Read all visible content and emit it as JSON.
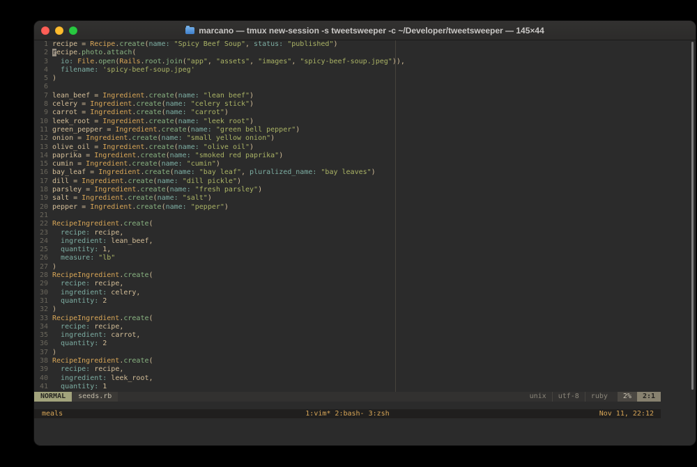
{
  "window": {
    "title": "marcano — tmux new-session -s tweetsweeper -c ~/Developer/tweetsweeper — 145×44"
  },
  "colors": {
    "terminal_bg": "#2b2b2b",
    "fg": "#d4be98",
    "class": "#d8a657",
    "method": "#89b482",
    "key": "#7daea3",
    "string": "#aab365",
    "number": "#d4be98",
    "line_number": "#6b675c",
    "mode_bg": "#a2a37c",
    "tmux_accent": "#d8a657"
  },
  "editor": {
    "cursor": {
      "line": 2,
      "col": 1
    },
    "lines": [
      {
        "num": 1,
        "tokens": [
          [
            "v",
            "recipe = "
          ],
          [
            "c",
            "Recipe"
          ],
          [
            "v",
            "."
          ],
          [
            "m",
            "create"
          ],
          [
            "v",
            "("
          ],
          [
            "k",
            "name:"
          ],
          [
            "v",
            " "
          ],
          [
            "s",
            "\"Spicy Beef Soup\""
          ],
          [
            "v",
            ", "
          ],
          [
            "k",
            "status:"
          ],
          [
            "v",
            " "
          ],
          [
            "s",
            "\"published\""
          ],
          [
            "v",
            ")"
          ]
        ]
      },
      {
        "num": 2,
        "tokens": [
          [
            "v",
            "recipe."
          ],
          [
            "m",
            "photo"
          ],
          [
            "v",
            "."
          ],
          [
            "m",
            "attach"
          ],
          [
            "v",
            "("
          ]
        ]
      },
      {
        "num": 3,
        "tokens": [
          [
            "v",
            "  "
          ],
          [
            "k",
            "io:"
          ],
          [
            "v",
            " "
          ],
          [
            "c",
            "File"
          ],
          [
            "v",
            "."
          ],
          [
            "m",
            "open"
          ],
          [
            "v",
            "("
          ],
          [
            "c",
            "Rails"
          ],
          [
            "v",
            "."
          ],
          [
            "m",
            "root"
          ],
          [
            "v",
            "."
          ],
          [
            "m",
            "join"
          ],
          [
            "v",
            "("
          ],
          [
            "s",
            "\"app\""
          ],
          [
            "v",
            ", "
          ],
          [
            "s",
            "\"assets\""
          ],
          [
            "v",
            ", "
          ],
          [
            "s",
            "\"images\""
          ],
          [
            "v",
            ", "
          ],
          [
            "s",
            "\"spicy-beef-soup.jpeg\""
          ],
          [
            "v",
            ")),"
          ]
        ]
      },
      {
        "num": 4,
        "tokens": [
          [
            "v",
            "  "
          ],
          [
            "k",
            "filename:"
          ],
          [
            "v",
            " "
          ],
          [
            "s",
            "'spicy-beef-soup.jpeg'"
          ]
        ]
      },
      {
        "num": 5,
        "tokens": [
          [
            "v",
            ")"
          ]
        ]
      },
      {
        "num": 6,
        "tokens": []
      },
      {
        "num": 7,
        "tokens": [
          [
            "v",
            "lean_beef = "
          ],
          [
            "c",
            "Ingredient"
          ],
          [
            "v",
            "."
          ],
          [
            "m",
            "create"
          ],
          [
            "v",
            "("
          ],
          [
            "k",
            "name:"
          ],
          [
            "v",
            " "
          ],
          [
            "s",
            "\"lean beef\""
          ],
          [
            "v",
            ")"
          ]
        ]
      },
      {
        "num": 8,
        "tokens": [
          [
            "v",
            "celery = "
          ],
          [
            "c",
            "Ingredient"
          ],
          [
            "v",
            "."
          ],
          [
            "m",
            "create"
          ],
          [
            "v",
            "("
          ],
          [
            "k",
            "name:"
          ],
          [
            "v",
            " "
          ],
          [
            "s",
            "\"celery stick\""
          ],
          [
            "v",
            ")"
          ]
        ]
      },
      {
        "num": 9,
        "tokens": [
          [
            "v",
            "carrot = "
          ],
          [
            "c",
            "Ingredient"
          ],
          [
            "v",
            "."
          ],
          [
            "m",
            "create"
          ],
          [
            "v",
            "("
          ],
          [
            "k",
            "name:"
          ],
          [
            "v",
            " "
          ],
          [
            "s",
            "\"carrot\""
          ],
          [
            "v",
            ")"
          ]
        ]
      },
      {
        "num": 10,
        "tokens": [
          [
            "v",
            "leek_root = "
          ],
          [
            "c",
            "Ingredient"
          ],
          [
            "v",
            "."
          ],
          [
            "m",
            "create"
          ],
          [
            "v",
            "("
          ],
          [
            "k",
            "name:"
          ],
          [
            "v",
            " "
          ],
          [
            "s",
            "\"leek root\""
          ],
          [
            "v",
            ")"
          ]
        ]
      },
      {
        "num": 11,
        "tokens": [
          [
            "v",
            "green_pepper = "
          ],
          [
            "c",
            "Ingredient"
          ],
          [
            "v",
            "."
          ],
          [
            "m",
            "create"
          ],
          [
            "v",
            "("
          ],
          [
            "k",
            "name:"
          ],
          [
            "v",
            " "
          ],
          [
            "s",
            "\"green bell pepper\""
          ],
          [
            "v",
            ")"
          ]
        ]
      },
      {
        "num": 12,
        "tokens": [
          [
            "v",
            "onion = "
          ],
          [
            "c",
            "Ingredient"
          ],
          [
            "v",
            "."
          ],
          [
            "m",
            "create"
          ],
          [
            "v",
            "("
          ],
          [
            "k",
            "name:"
          ],
          [
            "v",
            " "
          ],
          [
            "s",
            "\"small yellow onion\""
          ],
          [
            "v",
            ")"
          ]
        ]
      },
      {
        "num": 13,
        "tokens": [
          [
            "v",
            "olive_oil = "
          ],
          [
            "c",
            "Ingredient"
          ],
          [
            "v",
            "."
          ],
          [
            "m",
            "create"
          ],
          [
            "v",
            "("
          ],
          [
            "k",
            "name:"
          ],
          [
            "v",
            " "
          ],
          [
            "s",
            "\"olive oil\""
          ],
          [
            "v",
            ")"
          ]
        ]
      },
      {
        "num": 14,
        "tokens": [
          [
            "v",
            "paprika = "
          ],
          [
            "c",
            "Ingredient"
          ],
          [
            "v",
            "."
          ],
          [
            "m",
            "create"
          ],
          [
            "v",
            "("
          ],
          [
            "k",
            "name:"
          ],
          [
            "v",
            " "
          ],
          [
            "s",
            "\"smoked red paprika\""
          ],
          [
            "v",
            ")"
          ]
        ]
      },
      {
        "num": 15,
        "tokens": [
          [
            "v",
            "cumin = "
          ],
          [
            "c",
            "Ingredient"
          ],
          [
            "v",
            "."
          ],
          [
            "m",
            "create"
          ],
          [
            "v",
            "("
          ],
          [
            "k",
            "name:"
          ],
          [
            "v",
            " "
          ],
          [
            "s",
            "\"cumin\""
          ],
          [
            "v",
            ")"
          ]
        ]
      },
      {
        "num": 16,
        "tokens": [
          [
            "v",
            "bay_leaf = "
          ],
          [
            "c",
            "Ingredient"
          ],
          [
            "v",
            "."
          ],
          [
            "m",
            "create"
          ],
          [
            "v",
            "("
          ],
          [
            "k",
            "name:"
          ],
          [
            "v",
            " "
          ],
          [
            "s",
            "\"bay leaf\""
          ],
          [
            "v",
            ", "
          ],
          [
            "k",
            "pluralized_name:"
          ],
          [
            "v",
            " "
          ],
          [
            "s",
            "\"bay leaves\""
          ],
          [
            "v",
            ")"
          ]
        ]
      },
      {
        "num": 17,
        "tokens": [
          [
            "v",
            "dill = "
          ],
          [
            "c",
            "Ingredient"
          ],
          [
            "v",
            "."
          ],
          [
            "m",
            "create"
          ],
          [
            "v",
            "("
          ],
          [
            "k",
            "name:"
          ],
          [
            "v",
            " "
          ],
          [
            "s",
            "\"dill pickle\""
          ],
          [
            "v",
            ")"
          ]
        ]
      },
      {
        "num": 18,
        "tokens": [
          [
            "v",
            "parsley = "
          ],
          [
            "c",
            "Ingredient"
          ],
          [
            "v",
            "."
          ],
          [
            "m",
            "create"
          ],
          [
            "v",
            "("
          ],
          [
            "k",
            "name:"
          ],
          [
            "v",
            " "
          ],
          [
            "s",
            "\"fresh parsley\""
          ],
          [
            "v",
            ")"
          ]
        ]
      },
      {
        "num": 19,
        "tokens": [
          [
            "v",
            "salt = "
          ],
          [
            "c",
            "Ingredient"
          ],
          [
            "v",
            "."
          ],
          [
            "m",
            "create"
          ],
          [
            "v",
            "("
          ],
          [
            "k",
            "name:"
          ],
          [
            "v",
            " "
          ],
          [
            "s",
            "\"salt\""
          ],
          [
            "v",
            ")"
          ]
        ]
      },
      {
        "num": 20,
        "tokens": [
          [
            "v",
            "pepper = "
          ],
          [
            "c",
            "Ingredient"
          ],
          [
            "v",
            "."
          ],
          [
            "m",
            "create"
          ],
          [
            "v",
            "("
          ],
          [
            "k",
            "name:"
          ],
          [
            "v",
            " "
          ],
          [
            "s",
            "\"pepper\""
          ],
          [
            "v",
            ")"
          ]
        ]
      },
      {
        "num": 21,
        "tokens": []
      },
      {
        "num": 22,
        "tokens": [
          [
            "c",
            "RecipeIngredient"
          ],
          [
            "v",
            "."
          ],
          [
            "m",
            "create"
          ],
          [
            "v",
            "("
          ]
        ]
      },
      {
        "num": 23,
        "tokens": [
          [
            "v",
            "  "
          ],
          [
            "k",
            "recipe:"
          ],
          [
            "v",
            " recipe,"
          ]
        ]
      },
      {
        "num": 24,
        "tokens": [
          [
            "v",
            "  "
          ],
          [
            "k",
            "ingredient:"
          ],
          [
            "v",
            " lean_beef,"
          ]
        ]
      },
      {
        "num": 25,
        "tokens": [
          [
            "v",
            "  "
          ],
          [
            "k",
            "quantity:"
          ],
          [
            "v",
            " "
          ],
          [
            "n",
            "1"
          ],
          [
            "v",
            ","
          ]
        ]
      },
      {
        "num": 26,
        "tokens": [
          [
            "v",
            "  "
          ],
          [
            "k",
            "measure:"
          ],
          [
            "v",
            " "
          ],
          [
            "s",
            "\"lb\""
          ]
        ]
      },
      {
        "num": 27,
        "tokens": [
          [
            "v",
            ")"
          ]
        ]
      },
      {
        "num": 28,
        "tokens": [
          [
            "c",
            "RecipeIngredient"
          ],
          [
            "v",
            "."
          ],
          [
            "m",
            "create"
          ],
          [
            "v",
            "("
          ]
        ]
      },
      {
        "num": 29,
        "tokens": [
          [
            "v",
            "  "
          ],
          [
            "k",
            "recipe:"
          ],
          [
            "v",
            " recipe,"
          ]
        ]
      },
      {
        "num": 30,
        "tokens": [
          [
            "v",
            "  "
          ],
          [
            "k",
            "ingredient:"
          ],
          [
            "v",
            " celery,"
          ]
        ]
      },
      {
        "num": 31,
        "tokens": [
          [
            "v",
            "  "
          ],
          [
            "k",
            "quantity:"
          ],
          [
            "v",
            " "
          ],
          [
            "n",
            "2"
          ]
        ]
      },
      {
        "num": 32,
        "tokens": [
          [
            "v",
            ")"
          ]
        ]
      },
      {
        "num": 33,
        "tokens": [
          [
            "c",
            "RecipeIngredient"
          ],
          [
            "v",
            "."
          ],
          [
            "m",
            "create"
          ],
          [
            "v",
            "("
          ]
        ]
      },
      {
        "num": 34,
        "tokens": [
          [
            "v",
            "  "
          ],
          [
            "k",
            "recipe:"
          ],
          [
            "v",
            " recipe,"
          ]
        ]
      },
      {
        "num": 35,
        "tokens": [
          [
            "v",
            "  "
          ],
          [
            "k",
            "ingredient:"
          ],
          [
            "v",
            " carrot,"
          ]
        ]
      },
      {
        "num": 36,
        "tokens": [
          [
            "v",
            "  "
          ],
          [
            "k",
            "quantity:"
          ],
          [
            "v",
            " "
          ],
          [
            "n",
            "2"
          ]
        ]
      },
      {
        "num": 37,
        "tokens": [
          [
            "v",
            ")"
          ]
        ]
      },
      {
        "num": 38,
        "tokens": [
          [
            "c",
            "RecipeIngredient"
          ],
          [
            "v",
            "."
          ],
          [
            "m",
            "create"
          ],
          [
            "v",
            "("
          ]
        ]
      },
      {
        "num": 39,
        "tokens": [
          [
            "v",
            "  "
          ],
          [
            "k",
            "recipe:"
          ],
          [
            "v",
            " recipe,"
          ]
        ]
      },
      {
        "num": 40,
        "tokens": [
          [
            "v",
            "  "
          ],
          [
            "k",
            "ingredient:"
          ],
          [
            "v",
            " leek_root,"
          ]
        ]
      },
      {
        "num": 41,
        "tokens": [
          [
            "v",
            "  "
          ],
          [
            "k",
            "quantity:"
          ],
          [
            "v",
            " "
          ],
          [
            "n",
            "1"
          ]
        ]
      }
    ]
  },
  "statusline": {
    "mode": "NORMAL",
    "filename": "seeds.rb",
    "fileformat": "unix",
    "encoding": "utf-8",
    "filetype": "ruby",
    "percent": "2%",
    "position": "2:1"
  },
  "tmux": {
    "session": "meals",
    "windows": "1:vim* 2:bash- 3:zsh",
    "clock": "Nov 11, 22:12"
  }
}
